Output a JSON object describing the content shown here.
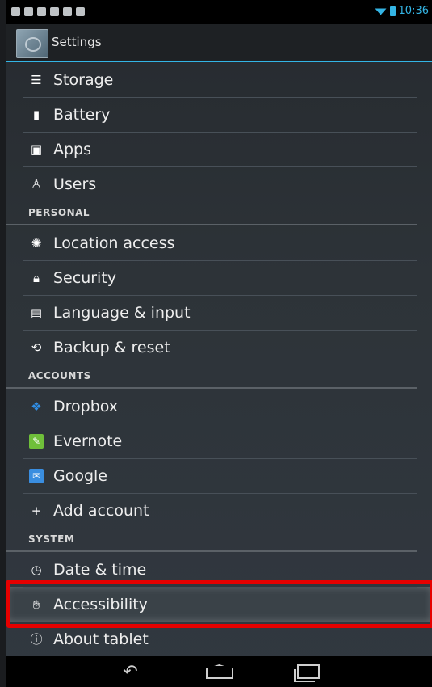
{
  "statusbar": {
    "time": "10:36"
  },
  "actionbar": {
    "title": "Settings"
  },
  "sections": {
    "personal": "PERSONAL",
    "accounts": "ACCOUNTS",
    "system": "SYSTEM"
  },
  "items": {
    "storage": "Storage",
    "battery": "Battery",
    "apps": "Apps",
    "users": "Users",
    "location": "Location access",
    "security": "Security",
    "language": "Language & input",
    "backup": "Backup & reset",
    "dropbox": "Dropbox",
    "evernote": "Evernote",
    "google": "Google",
    "add_account": "Add account",
    "datetime": "Date & time",
    "accessibility": "Accessibility",
    "about": "About tablet"
  },
  "colors": {
    "accent": "#33b5e5",
    "highlight_border": "#e60000"
  }
}
